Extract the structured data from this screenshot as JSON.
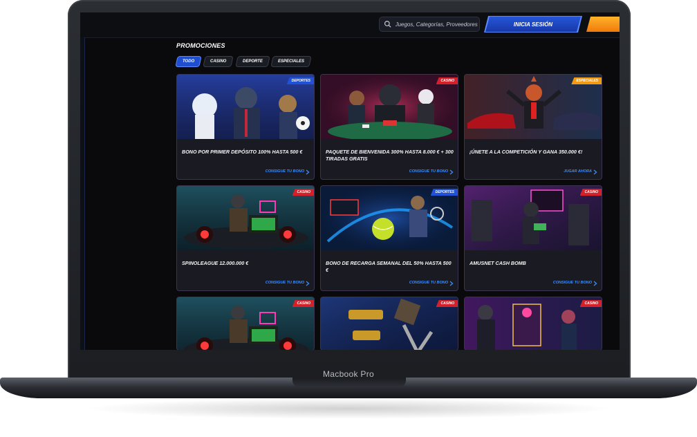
{
  "device": {
    "label": "Macbook Pro"
  },
  "header": {
    "search_placeholder": "Juegos, Categorías, Proveedores",
    "login_label": "INICIA SESIÓN"
  },
  "section": {
    "title": "PROMOCIONES"
  },
  "filters": [
    {
      "label": "TODO",
      "active": true
    },
    {
      "label": "CASINO",
      "active": false
    },
    {
      "label": "DEPORTE",
      "active": false
    },
    {
      "label": "ESPECIALES",
      "active": false
    }
  ],
  "cards": [
    {
      "badge": "DEPORTES",
      "badge_type": "deportes",
      "title": "BONO POR PRIMER DEPÓSITO 100% HASTA 500 €",
      "link": "CONSIGUE TU BONO",
      "scene": "sports"
    },
    {
      "badge": "CASINO",
      "badge_type": "casino",
      "title": "PAQUETE DE BIENVENIDA 300% HASTA 8.000 € + 300 TIRADAS GRATIS",
      "link": "CONSIGUE TU BONO",
      "scene": "poker"
    },
    {
      "badge": "ESPECIALES",
      "badge_type": "especiales",
      "title": "¡ÚNETE A LA COMPETICIÓN Y GANA 350.000 €!",
      "link": "JUGAR AHORA",
      "scene": "cars"
    },
    {
      "badge": "CASINO",
      "badge_type": "casino",
      "title": "SPINOLEAGUE 12.000.000 €",
      "link": "CONSIGUE TU BONO",
      "scene": "race"
    },
    {
      "badge": "DEPORTES",
      "badge_type": "deportes",
      "title": "BONO DE RECARGA SEMANAL DEL 50% HASTA 500 €",
      "link": "CONSIGUE TU BONO",
      "scene": "tennis"
    },
    {
      "badge": "CASINO",
      "badge_type": "casino",
      "title": "AMUSNET CASH BOMB",
      "link": "CONSIGUE TU BONO",
      "scene": "cash"
    },
    {
      "badge": "CASINO",
      "badge_type": "casino",
      "title": "",
      "link": "",
      "scene": "race"
    },
    {
      "badge": "CASINO",
      "badge_type": "casino",
      "title": "",
      "link": "",
      "scene": "gold"
    },
    {
      "badge": "CASINO",
      "badge_type": "casino",
      "title": "",
      "link": "",
      "scene": "slots"
    }
  ],
  "colors": {
    "accent_blue": "#2051d6",
    "casino_red": "#d4202a",
    "special_orange": "#f29a12",
    "link_blue": "#3b8cff"
  }
}
